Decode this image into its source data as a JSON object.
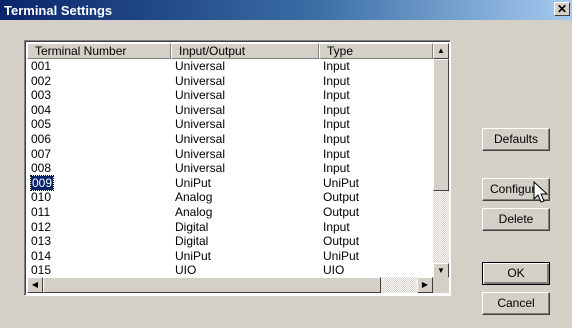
{
  "window": {
    "title": "Terminal Settings",
    "close_label": "✕"
  },
  "table": {
    "columns": [
      "Terminal Number",
      "Input/Output",
      "Type"
    ],
    "rows": [
      [
        "001",
        "Universal",
        "Input"
      ],
      [
        "002",
        "Universal",
        "Input"
      ],
      [
        "003",
        "Universal",
        "Input"
      ],
      [
        "004",
        "Universal",
        "Input"
      ],
      [
        "005",
        "Universal",
        "Input"
      ],
      [
        "006",
        "Universal",
        "Input"
      ],
      [
        "007",
        "Universal",
        "Input"
      ],
      [
        "008",
        "Universal",
        "Input"
      ],
      [
        "009",
        "UniPut",
        "UniPut"
      ],
      [
        "010",
        "Analog",
        "Output"
      ],
      [
        "011",
        "Analog",
        "Output"
      ],
      [
        "012",
        "Digital",
        "Input"
      ],
      [
        "013",
        "Digital",
        "Output"
      ],
      [
        "014",
        "UniPut",
        "UniPut"
      ],
      [
        "015",
        "UIO",
        "UIO"
      ]
    ],
    "selected_row": "009"
  },
  "buttons": {
    "defaults": "Defaults",
    "configure": "Configure",
    "delete": "Delete",
    "ok": "OK",
    "cancel": "Cancel"
  },
  "icons": {
    "close": "close-icon",
    "scroll_up": "arrow-up-icon",
    "scroll_down": "arrow-down-icon",
    "scroll_left": "arrow-left-icon",
    "scroll_right": "arrow-right-icon",
    "cursor": "mouse-pointer-icon"
  }
}
